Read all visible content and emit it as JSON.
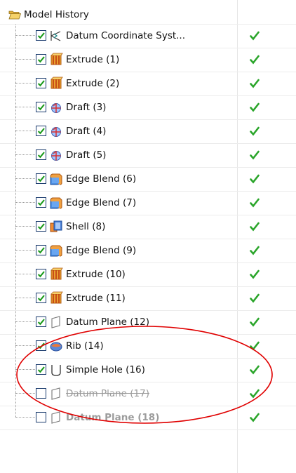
{
  "root": {
    "label": "Model History",
    "icon": "open-folder-icon"
  },
  "rows": [
    {
      "label": "Datum Coordinate Syst...",
      "icon": "datum-csys-icon",
      "checked": true,
      "status": "ok",
      "status_icon": "green-check-icon"
    },
    {
      "label": "Extrude (1)",
      "icon": "extrude-icon",
      "checked": true,
      "status": "ok",
      "status_icon": "green-check-icon"
    },
    {
      "label": "Extrude (2)",
      "icon": "extrude-icon",
      "checked": true,
      "status": "ok",
      "status_icon": "green-check-icon"
    },
    {
      "label": "Draft (3)",
      "icon": "draft-icon",
      "checked": true,
      "status": "ok",
      "status_icon": "green-check-icon"
    },
    {
      "label": "Draft (4)",
      "icon": "draft-icon",
      "checked": true,
      "status": "ok",
      "status_icon": "green-check-icon"
    },
    {
      "label": "Draft (5)",
      "icon": "draft-icon",
      "checked": true,
      "status": "ok",
      "status_icon": "green-check-icon"
    },
    {
      "label": "Edge Blend (6)",
      "icon": "edge-blend-icon",
      "checked": true,
      "status": "ok",
      "status_icon": "green-check-icon"
    },
    {
      "label": "Edge Blend (7)",
      "icon": "edge-blend-icon",
      "checked": true,
      "status": "ok",
      "status_icon": "green-check-icon"
    },
    {
      "label": "Shell (8)",
      "icon": "shell-icon",
      "checked": true,
      "status": "ok",
      "status_icon": "green-check-icon"
    },
    {
      "label": "Edge Blend (9)",
      "icon": "edge-blend-icon",
      "checked": true,
      "status": "ok",
      "status_icon": "green-check-icon"
    },
    {
      "label": "Extrude (10)",
      "icon": "extrude-icon",
      "checked": true,
      "status": "ok",
      "status_icon": "green-check-icon"
    },
    {
      "label": "Extrude (11)",
      "icon": "extrude-icon",
      "checked": true,
      "status": "ok",
      "status_icon": "green-check-icon"
    },
    {
      "label": "Datum Plane (12)",
      "icon": "datum-plane-icon",
      "checked": true,
      "status": "ok",
      "status_icon": "green-check-icon"
    },
    {
      "label": "Rib (14)",
      "icon": "rib-icon",
      "checked": true,
      "status": "ok",
      "status_icon": "green-check-icon"
    },
    {
      "label": "Simple Hole (16)",
      "icon": "simple-hole-icon",
      "checked": true,
      "status": "ok",
      "status_icon": "green-check-icon"
    },
    {
      "label": "Datum Plane (17)",
      "icon": "datum-plane-icon",
      "checked": false,
      "status": "ok",
      "status_icon": "green-check-icon",
      "struck": true
    },
    {
      "label": "Datum Plane (18)",
      "icon": "datum-plane-icon",
      "checked": false,
      "status": "ok",
      "status_icon": "green-check-icon",
      "bold": true
    }
  ],
  "annotation": {
    "shape": "ellipse",
    "color": "#e00000"
  },
  "colors": {
    "check_green": "#1a9a1a",
    "tick_green": "#2aa52a",
    "checkbox_border": "#1b3c6e",
    "disabled_text": "#9a9a9a"
  }
}
